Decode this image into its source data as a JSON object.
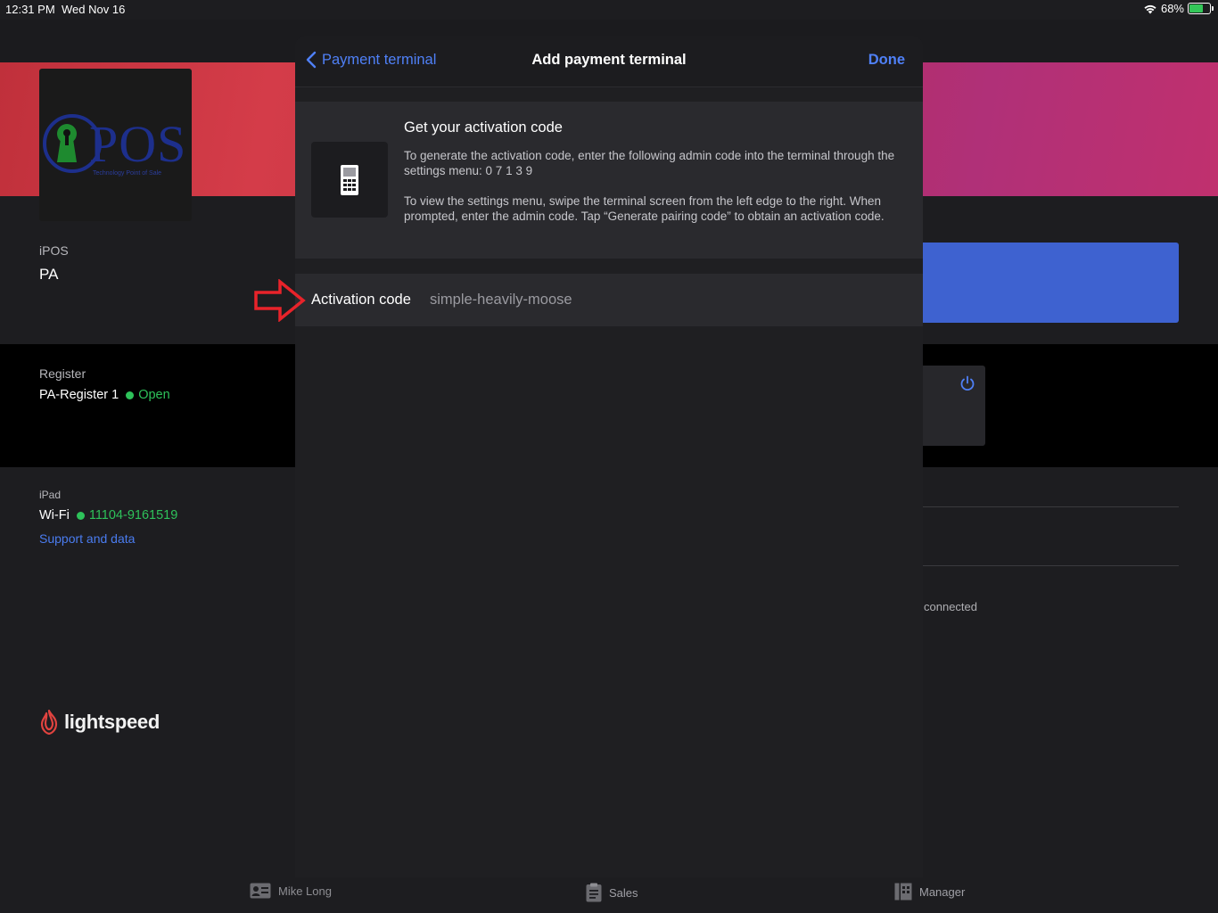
{
  "status_bar": {
    "time": "12:31 PM",
    "date": "Wed Nov 16",
    "battery": "68%",
    "battery_level": 0.68
  },
  "background": {
    "logo_text": "POS",
    "logo_subtitle": "Technology Point of Sale",
    "store_label": "iPOS",
    "store_name": "PA",
    "register_label": "Register",
    "register_name": "PA-Register 1",
    "register_status": "Open",
    "ipad_label": "iPad",
    "wifi_label": "Wi-Fi",
    "wifi_network": "11104-9161519",
    "support_link": "Support and data",
    "brand_name": "lightspeed",
    "connected_text": "connected"
  },
  "tab_bar": {
    "user": "Mike Long",
    "sales": "Sales",
    "manager": "Manager"
  },
  "modal": {
    "back_label": "Payment terminal",
    "title": "Add payment terminal",
    "done_label": "Done",
    "info_title": "Get your activation code",
    "info_p1": "To generate the activation code, enter the following admin code into the terminal through the settings menu: 0 7 1 3 9",
    "info_p2": "To view the settings menu, swipe the terminal screen from the left edge to the right. When prompted, enter the admin code. Tap “Generate pairing code” to obtain an activation code.",
    "activation_label": "Activation code",
    "activation_value": "simple-heavily-moose"
  },
  "colors": {
    "accent_blue": "#4f80f7",
    "status_green": "#2ec25a",
    "annotation_red": "#e8232a"
  },
  "icons": [
    "wifi-icon",
    "battery-icon",
    "chevron-left-icon",
    "terminal-icon",
    "power-icon",
    "lightspeed-flame-icon",
    "user-card-icon",
    "clipboard-icon",
    "manager-icon",
    "arrow-right-annotation"
  ]
}
